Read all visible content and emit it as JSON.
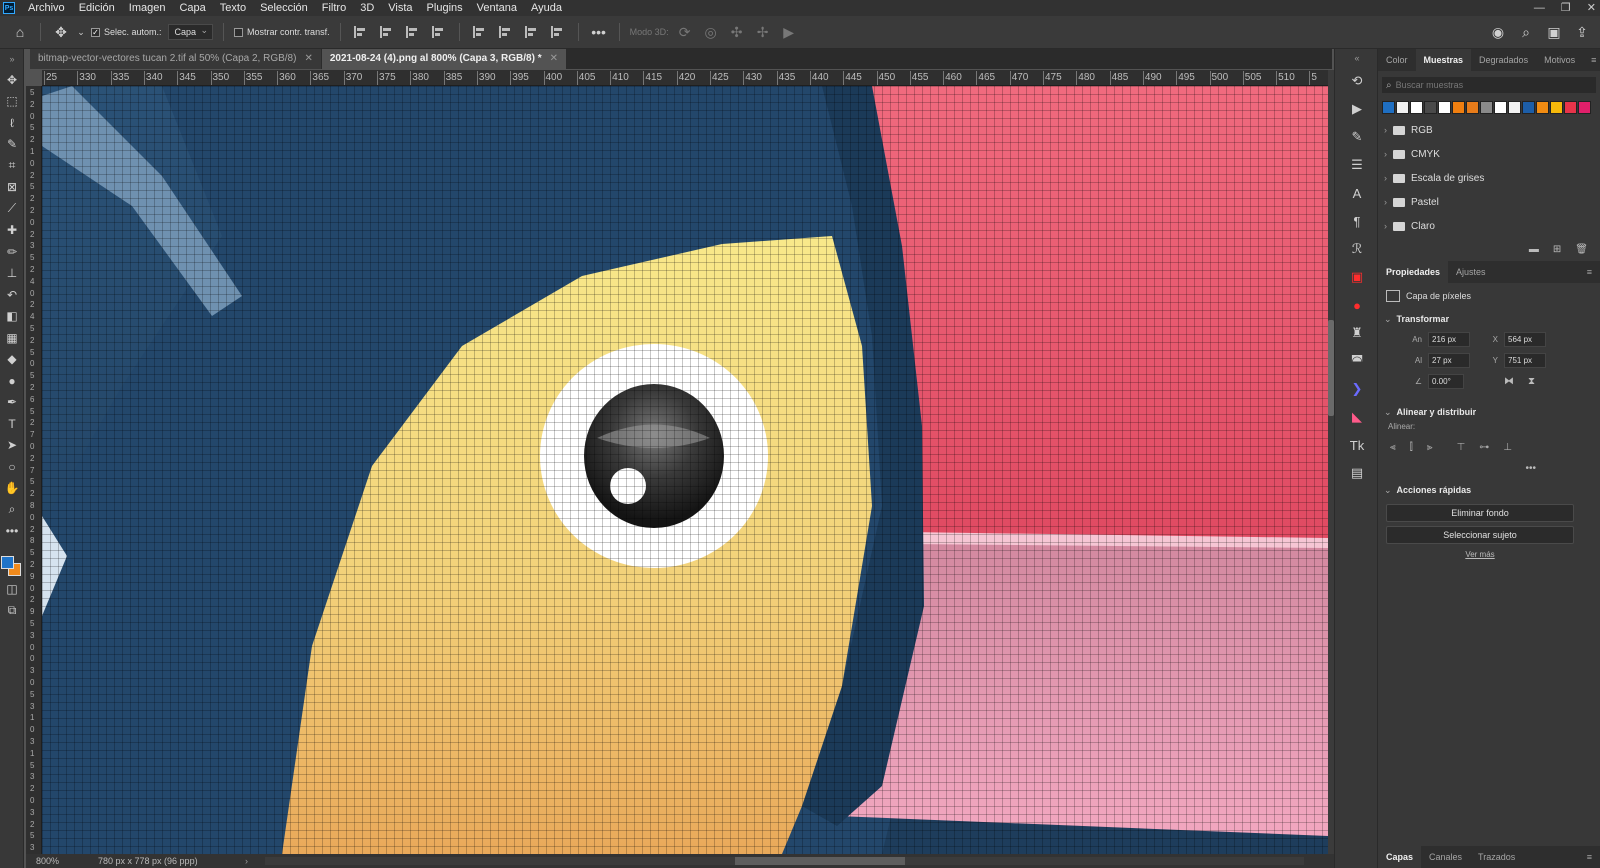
{
  "app": {
    "logo": "Ps",
    "menus": [
      "Archivo",
      "Edición",
      "Imagen",
      "Capa",
      "Texto",
      "Selección",
      "Filtro",
      "3D",
      "Vista",
      "Plugins",
      "Ventana",
      "Ayuda"
    ]
  },
  "options": {
    "auto_select_label": "Selec. autom.:",
    "auto_select_value": "Capa",
    "show_transform_label": "Mostrar contr. transf.",
    "mode_3d_label": "Modo 3D:",
    "more": "•••"
  },
  "tabs": [
    {
      "label": "bitmap-vector-vectores tucan 2.tif al 50% (Capa 2, RGB/8)",
      "active": false
    },
    {
      "label": "2021-08-24 (4).png al 800% (Capa 3, RGB/8) *",
      "active": true
    }
  ],
  "ruler": {
    "h_ticks": [
      "25",
      "330",
      "335",
      "340",
      "345",
      "350",
      "355",
      "360",
      "365",
      "370",
      "375",
      "380",
      "385",
      "390",
      "395",
      "400",
      "405",
      "410",
      "415",
      "420",
      "425",
      "430",
      "435",
      "440",
      "445",
      "450",
      "455",
      "460",
      "465",
      "470",
      "475",
      "480",
      "485",
      "490",
      "495",
      "500",
      "505",
      "510",
      "5"
    ],
    "v_ticks": [
      "5",
      "2",
      "0",
      "5",
      "2",
      "1",
      "0",
      "2",
      "5",
      "2",
      "2",
      "0",
      "2",
      "3",
      "5",
      "2",
      "4",
      "0",
      "2",
      "4",
      "5",
      "2",
      "5",
      "0",
      "5",
      "2",
      "6",
      "5",
      "2",
      "7",
      "0",
      "2",
      "7",
      "5",
      "2",
      "8",
      "0",
      "2",
      "8",
      "5",
      "2",
      "9",
      "0",
      "2",
      "9",
      "5",
      "3",
      "0",
      "0",
      "3",
      "0",
      "5",
      "3",
      "1",
      "0",
      "3",
      "1",
      "5",
      "3",
      "2",
      "0",
      "3",
      "2",
      "5",
      "3"
    ]
  },
  "status": {
    "zoom": "800%",
    "doc_info": "780 px x 778 px (96 ppp)"
  },
  "swatches_panel": {
    "tabs": [
      "Color",
      "Muestras",
      "Degradados",
      "Motivos"
    ],
    "active_tab": "Muestras",
    "search_placeholder": "Buscar muestras",
    "recent_colors": [
      "#1f6fc2",
      "#f2f2f2",
      "#ffffff",
      "#4a4a4a",
      "#ffffff",
      "#f07f10",
      "#e87c1a",
      "#8a8a8a",
      "#ffffff",
      "#f1f1f1",
      "#1d5ea8",
      "#f28c12",
      "#f5b80a",
      "#e8344a",
      "#e01f6a"
    ],
    "folders": [
      "RGB",
      "CMYK",
      "Escala de grises",
      "Pastel",
      "Claro"
    ]
  },
  "properties_panel": {
    "tabs": [
      "Propiedades",
      "Ajustes"
    ],
    "active_tab": "Propiedades",
    "layer_type": "Capa de píxeles",
    "transform_title": "Transformar",
    "width_label": "An",
    "width_value": "216 px",
    "height_label": "Al",
    "height_value": "27 px",
    "x_label": "X",
    "x_value": "564 px",
    "y_label": "Y",
    "y_value": "751 px",
    "angle_value": "0.00°",
    "align_title": "Alinear y distribuir",
    "align_label": "Alinear:",
    "quick_actions_title": "Acciones rápidas",
    "remove_bg": "Eliminar fondo",
    "select_subject": "Seleccionar sujeto",
    "see_more": "Ver más"
  },
  "layers_panel": {
    "tabs": [
      "Capas",
      "Canales",
      "Trazados"
    ],
    "active_tab": "Capas"
  }
}
